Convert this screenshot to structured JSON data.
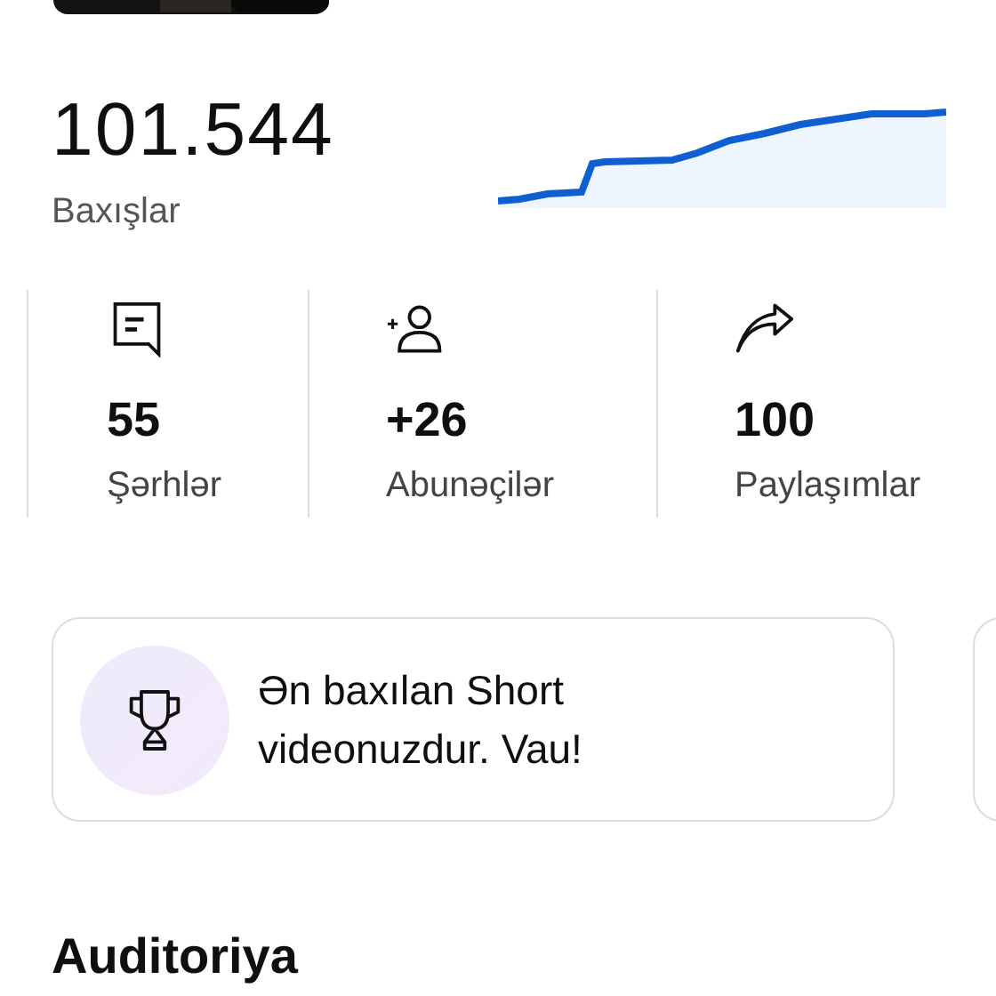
{
  "views": {
    "value": "101.544",
    "label": "Baxışlar"
  },
  "stats": [
    {
      "kind": "comments",
      "value": "55",
      "label": "Şərhlər"
    },
    {
      "kind": "subscribers",
      "value": "+26",
      "label": "Abunəçilər"
    },
    {
      "kind": "shares",
      "value": "100",
      "label": "Paylaşımlar"
    }
  ],
  "highlight": {
    "text": "Ən baxılan Short videonuzdur. Vau!"
  },
  "section_title": "Auditoriya"
}
